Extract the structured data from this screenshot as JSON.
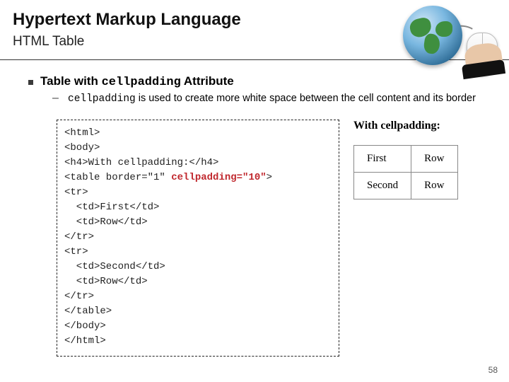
{
  "header": {
    "title": "Hypertext Markup Language",
    "subtitle": "HTML Table"
  },
  "bullet": {
    "prefix": "Table with ",
    "mono": "cellpadding",
    "suffix": " Attribute"
  },
  "sub": {
    "mono": "cellpadding",
    "rest": " is used to create more white space between the cell content and its border"
  },
  "code": {
    "l1": "<html>",
    "l2": "<body>",
    "l3": "<h4>With cellpadding:</h4>",
    "l4a": "<table border=\"1\" ",
    "l4b": "cellpadding=\"10\"",
    "l4c": ">",
    "l5": "<tr>",
    "l6": "  <td>First</td>",
    "l7": "  <td>Row</td>",
    "l8": "</tr>",
    "l9": "<tr>",
    "l10": "  <td>Second</td>",
    "l11": "  <td>Row</td>",
    "l12": "</tr>",
    "l13": "</table>",
    "l14": "</body>",
    "l15": "</html>"
  },
  "preview": {
    "heading": "With cellpadding:",
    "r1c1": "First",
    "r1c2": "Row",
    "r2c1": "Second",
    "r2c2": "Row"
  },
  "page_number": "58"
}
